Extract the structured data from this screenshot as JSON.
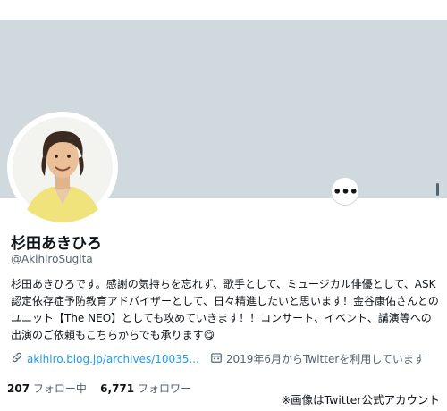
{
  "profile": {
    "name": "杉田あきひろ",
    "handle": "@AkihiroSugita",
    "bio": "杉田あきひろです。感謝の気持ちを忘れず、歌手として、ミュージカル俳優として、ASK認定依存症予防教育アドバイザーとして、日々精進したいと思います！金谷康佑さんとのユニット【The NEO】としても攻めていきます！！コンサート、イベント、講演等への出演のご依頼もこちらからでも承ります😋",
    "link": "akihiro.blog.jp/archives/10035...",
    "joined": "2019年6月からTwitterを利用しています",
    "following_count": "207",
    "following_label": "フォロー中",
    "followers_count": "6,771",
    "followers_label": "フォロワー"
  },
  "actions": {
    "more_label": "•••"
  },
  "credit": "※画像はTwitter公式アカウント",
  "colors": {
    "banner": "#cfd9de",
    "link": "#1d9bf0",
    "muted": "#536471",
    "text": "#0f1419"
  },
  "icons": [
    "link-icon",
    "calendar-icon",
    "more-icon"
  ]
}
